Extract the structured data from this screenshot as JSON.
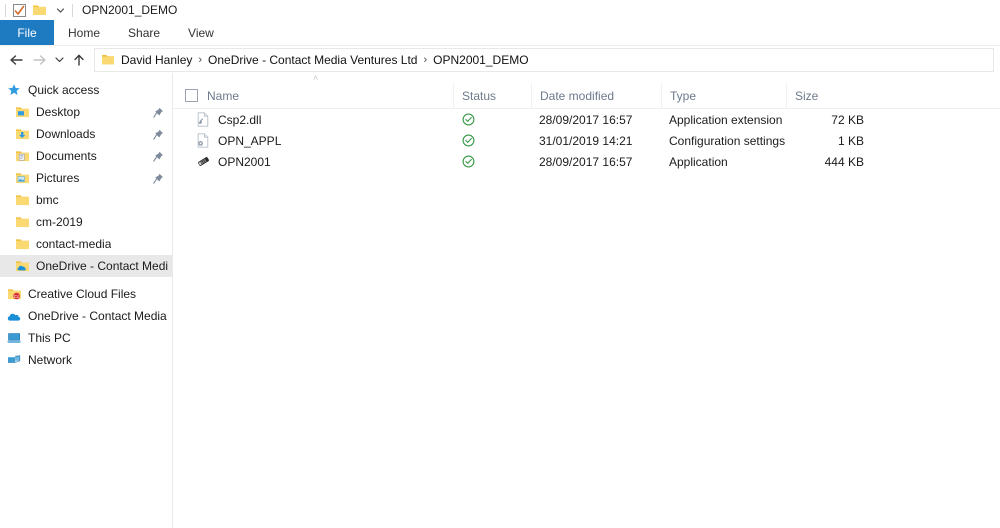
{
  "window": {
    "title": "OPN2001_DEMO"
  },
  "titlebar": {
    "quick_access_check_icon": "checkbox-check-icon",
    "folder_icon": "folder-icon",
    "customize_chevron_icon": "chevron-down-icon"
  },
  "ribbon": {
    "tabs": [
      {
        "label": "File",
        "name": "tab-file",
        "active": true
      },
      {
        "label": "Home",
        "name": "tab-home",
        "active": false
      },
      {
        "label": "Share",
        "name": "tab-share",
        "active": false
      },
      {
        "label": "View",
        "name": "tab-view",
        "active": false
      }
    ],
    "file_tab_color": "#1f7bc1"
  },
  "address": {
    "back_icon": "back-arrow-icon",
    "forward_icon": "forward-arrow-icon",
    "recent_icon": "chevron-down-icon",
    "up_icon": "up-arrow-icon",
    "folder_icon": "folder-icon",
    "breadcrumbs": [
      "David Hanley",
      "OneDrive - Contact Media Ventures Ltd",
      "OPN2001_DEMO"
    ],
    "separator": "›"
  },
  "sidebar": {
    "groups": [
      {
        "name": "quick-access",
        "items": [
          {
            "label": "Quick access",
            "icon": "star-icon",
            "indent": 0,
            "pinned": false,
            "selected": false
          },
          {
            "label": "Desktop",
            "icon": "folder-desktop-icon",
            "indent": 1,
            "pinned": true,
            "selected": false
          },
          {
            "label": "Downloads",
            "icon": "folder-download-icon",
            "indent": 1,
            "pinned": true,
            "selected": false
          },
          {
            "label": "Documents",
            "icon": "folder-documents-icon",
            "indent": 1,
            "pinned": true,
            "selected": false
          },
          {
            "label": "Pictures",
            "icon": "folder-pictures-icon",
            "indent": 1,
            "pinned": true,
            "selected": false
          },
          {
            "label": "bmc",
            "icon": "folder-icon",
            "indent": 1,
            "pinned": false,
            "selected": false
          },
          {
            "label": "cm-2019",
            "icon": "folder-icon",
            "indent": 1,
            "pinned": false,
            "selected": false
          },
          {
            "label": "contact-media",
            "icon": "folder-icon",
            "indent": 1,
            "pinned": false,
            "selected": false
          },
          {
            "label": "OneDrive - Contact Media Ve",
            "icon": "folder-onedrive-icon",
            "indent": 1,
            "pinned": false,
            "selected": true
          }
        ]
      },
      {
        "name": "cloud-and-devices",
        "items": [
          {
            "label": "Creative Cloud Files",
            "icon": "creative-cloud-icon",
            "indent": 0,
            "pinned": false,
            "selected": false
          },
          {
            "label": "OneDrive - Contact Media Ven",
            "icon": "onedrive-cloud-icon",
            "indent": 0,
            "pinned": false,
            "selected": false
          },
          {
            "label": "This PC",
            "icon": "this-pc-icon",
            "indent": 0,
            "pinned": false,
            "selected": false
          },
          {
            "label": "Network",
            "icon": "network-icon",
            "indent": 0,
            "pinned": false,
            "selected": false
          }
        ]
      }
    ]
  },
  "filelist": {
    "sort_caret": "˄",
    "select_all_checkbox": false,
    "columns": [
      {
        "label": "Name",
        "name": "column-header-name"
      },
      {
        "label": "Status",
        "name": "column-header-status"
      },
      {
        "label": "Date modified",
        "name": "column-header-date-modified"
      },
      {
        "label": "Type",
        "name": "column-header-type"
      },
      {
        "label": "Size",
        "name": "column-header-size"
      }
    ],
    "rows": [
      {
        "name": "Csp2.dll",
        "icon": "dll-file-icon",
        "status_icon": "sync-available-icon",
        "date_modified": "28/09/2017 16:57",
        "type": "Application extension",
        "size": "72 KB"
      },
      {
        "name": "OPN_APPL",
        "icon": "config-file-icon",
        "status_icon": "sync-available-icon",
        "date_modified": "31/01/2019 14:21",
        "type": "Configuration settings",
        "size": "1 KB"
      },
      {
        "name": "OPN2001",
        "icon": "application-exe-icon",
        "status_icon": "sync-available-icon",
        "date_modified": "28/09/2017 16:57",
        "type": "Application",
        "size": "444 KB"
      }
    ]
  },
  "colors": {
    "accent": "#1f7bc1",
    "folder_yellow": "#ffd04d",
    "sync_green": "#3a9a49",
    "header_text": "#6d7a8c",
    "selection_grey": "#e8e8e8"
  }
}
